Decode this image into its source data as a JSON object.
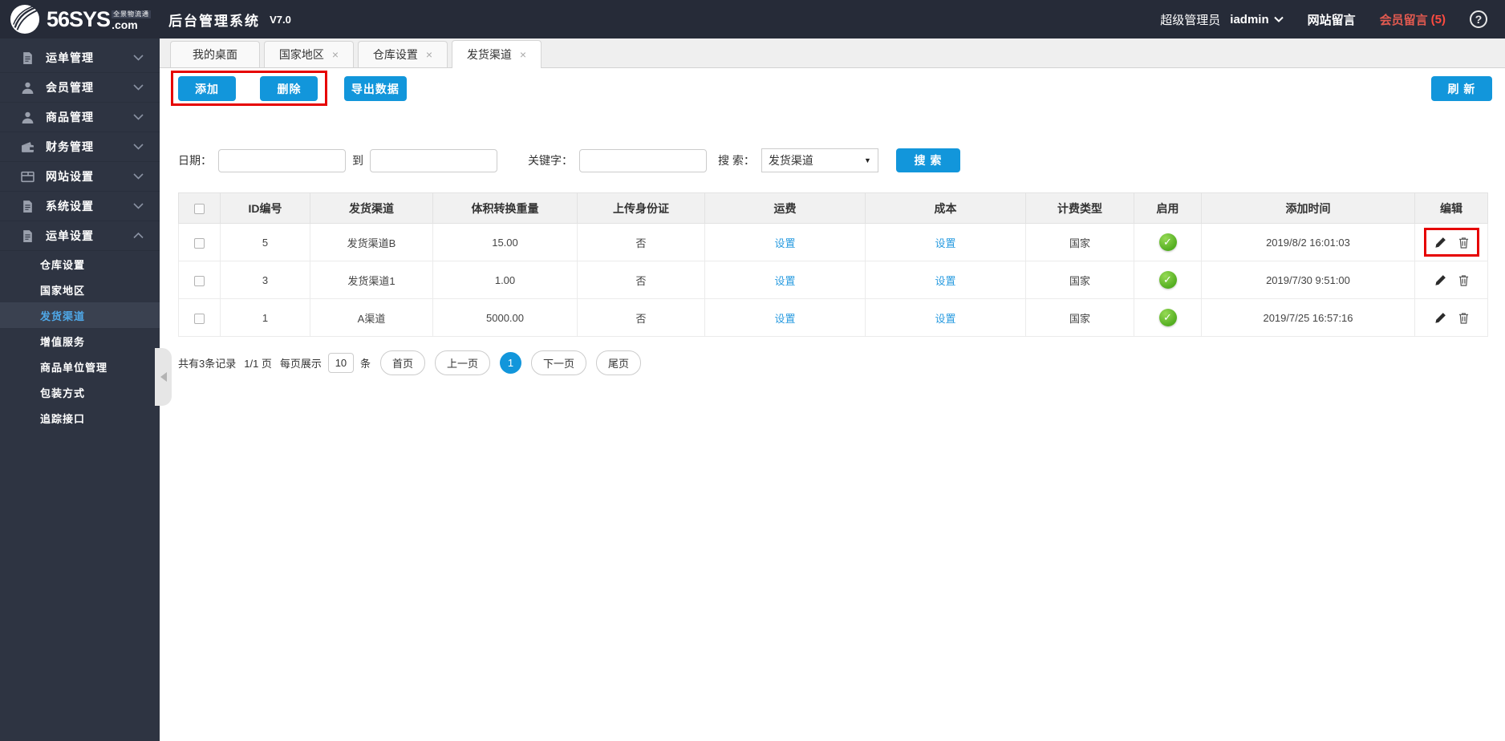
{
  "topbar": {
    "logo_main": "56SYS",
    "logo_tld": ".com",
    "logo_tagline": "全景物流通",
    "app_title": "后台管理系统",
    "version": "V7.0",
    "role": "超级管理员",
    "username": "iadmin",
    "site_messages": "网站留言",
    "member_messages": "会员留言",
    "member_messages_count": "(5)"
  },
  "sidebar": {
    "items": [
      {
        "label": "运单管理",
        "icon": "document-icon"
      },
      {
        "label": "会员管理",
        "icon": "user-icon"
      },
      {
        "label": "商品管理",
        "icon": "user-icon"
      },
      {
        "label": "财务管理",
        "icon": "wallet-icon"
      },
      {
        "label": "网站设置",
        "icon": "browser-icon"
      },
      {
        "label": "系统设置",
        "icon": "document-icon"
      },
      {
        "label": "运单设置",
        "icon": "document-icon"
      }
    ],
    "submenu": [
      {
        "label": "仓库设置",
        "active": false
      },
      {
        "label": "国家地区",
        "active": false
      },
      {
        "label": "发货渠道",
        "active": true
      },
      {
        "label": "增值服务",
        "active": false
      },
      {
        "label": "商品单位管理",
        "active": false
      },
      {
        "label": "包装方式",
        "active": false
      },
      {
        "label": "追踪接口",
        "active": false
      }
    ]
  },
  "tabs": [
    {
      "label": "我的桌面",
      "closable": false,
      "active": false
    },
    {
      "label": "国家地区",
      "closable": true,
      "active": false
    },
    {
      "label": "仓库设置",
      "closable": true,
      "active": false
    },
    {
      "label": "发货渠道",
      "closable": true,
      "active": true
    }
  ],
  "toolbar": {
    "add_label": "添加",
    "delete_label": "删除",
    "export_label": "导出数据",
    "refresh_label": "刷 新"
  },
  "filters": {
    "date_label": "日期：",
    "to_label": "到",
    "keyword_label": "关键字：",
    "search_label": "搜 索：",
    "search_select_value": "发货渠道",
    "search_button": "搜 索",
    "date_from_value": "",
    "date_to_value": "",
    "keyword_value": ""
  },
  "table": {
    "headers": {
      "id": "ID编号",
      "channel": "发货渠道",
      "volume_weight": "体积转换重量",
      "upload_id": "上传身份证",
      "freight": "运费",
      "cost": "成本",
      "billing_type": "计费类型",
      "enabled": "启用",
      "added_time": "添加时间",
      "edit": "编辑"
    },
    "rows": [
      {
        "id": "5",
        "channel": "发货渠道B",
        "volume_weight": "15.00",
        "upload_id": "否",
        "freight": "设置",
        "cost": "设置",
        "billing_type": "国家",
        "added_time": "2019/8/2 16:01:03"
      },
      {
        "id": "3",
        "channel": "发货渠道1",
        "volume_weight": "1.00",
        "upload_id": "否",
        "freight": "设置",
        "cost": "设置",
        "billing_type": "国家",
        "added_time": "2019/7/30 9:51:00"
      },
      {
        "id": "1",
        "channel": "A渠道",
        "volume_weight": "5000.00",
        "upload_id": "否",
        "freight": "设置",
        "cost": "设置",
        "billing_type": "国家",
        "added_time": "2019/7/25 16:57:16"
      }
    ]
  },
  "pagination": {
    "summary": "共有3条记录",
    "page_info": "1/1 页",
    "per_page_label": "每页展示",
    "per_page_value": "10",
    "unit": "条",
    "first": "首页",
    "prev": "上一页",
    "current": "1",
    "next": "下一页",
    "last": "尾页"
  },
  "icons": {
    "close": "×",
    "check": "✓",
    "dropdown_arrow": "▼",
    "help": "?"
  },
  "colors": {
    "accent": "#1296db",
    "annotation_red": "#e60000",
    "link_blue": "#2b9ce0",
    "success_green": "#54ae21",
    "topbar_bg": "#262b38",
    "sidebar_bg": "#2e3442"
  }
}
